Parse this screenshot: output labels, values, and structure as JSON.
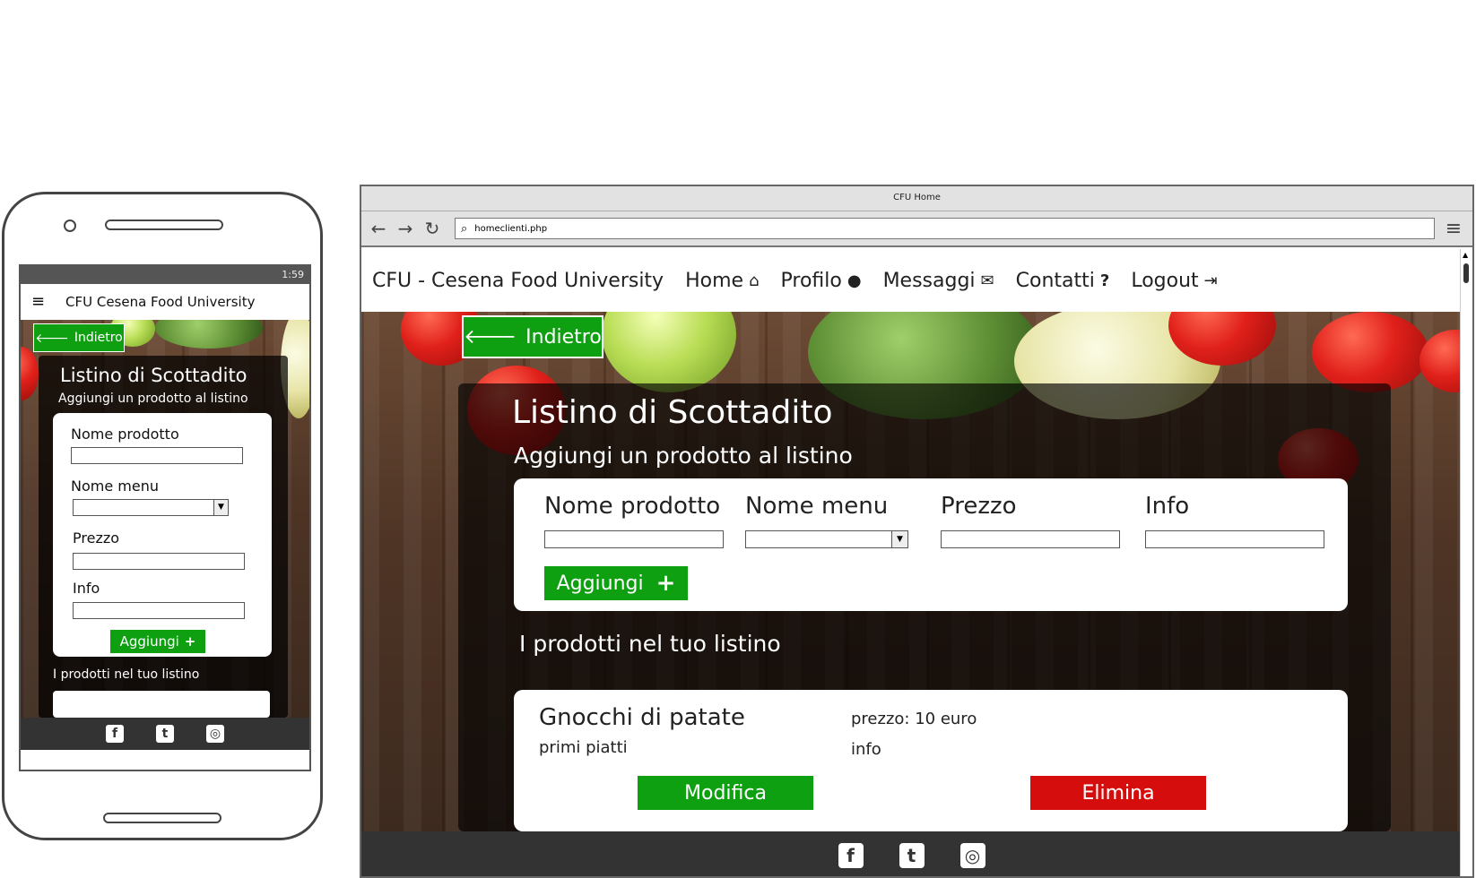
{
  "phone": {
    "status_text": "1:59",
    "header_title": "CFU Cesena Food University",
    "back_label": "Indietro",
    "title": "Listino di Scottadito",
    "subtitle": "Aggiungi un prodotto al listino",
    "form": {
      "product_name_label": "Nome prodotto",
      "product_name_value": "",
      "menu_name_label": "Nome menu",
      "menu_name_value": "",
      "price_label": "Prezzo",
      "price_value": "",
      "info_label": "Info",
      "info_value": "",
      "add_label": "Aggiungi"
    },
    "list_title": "I prodotti nel tuo listino",
    "footer_icons": [
      "facebook-icon",
      "twitter-icon",
      "instagram-icon"
    ]
  },
  "browser": {
    "window_title": "CFU Home",
    "url": "homeclienti.php",
    "nav": {
      "brand": "CFU - Cesena Food University",
      "home": "Home",
      "profile": "Profilo",
      "messages": "Messaggi",
      "contacts": "Contatti",
      "logout": "Logout"
    },
    "back_label": "Indietro",
    "title": "Listino di Scottadito",
    "subtitle": "Aggiungi un prodotto al listino",
    "form": {
      "product_name_label": "Nome prodotto",
      "product_name_value": "",
      "menu_name_label": "Nome menu",
      "menu_name_value": "",
      "price_label": "Prezzo",
      "price_value": "",
      "info_label": "Info",
      "info_value": "",
      "add_label": "Aggiungi"
    },
    "list_title": "I prodotti nel tuo listino",
    "products": [
      {
        "name": "Gnocchi di patate",
        "category": "primi piatti",
        "price": "prezzo: 10 euro",
        "info": "info",
        "edit_label": "Modifica",
        "delete_label": "Elimina"
      }
    ],
    "footer_icons": [
      "facebook-icon",
      "twitter-icon",
      "instagram-icon"
    ]
  },
  "colors": {
    "primary_green": "#0fa012",
    "danger_red": "#d60d0d",
    "footer_dark": "#333333"
  }
}
